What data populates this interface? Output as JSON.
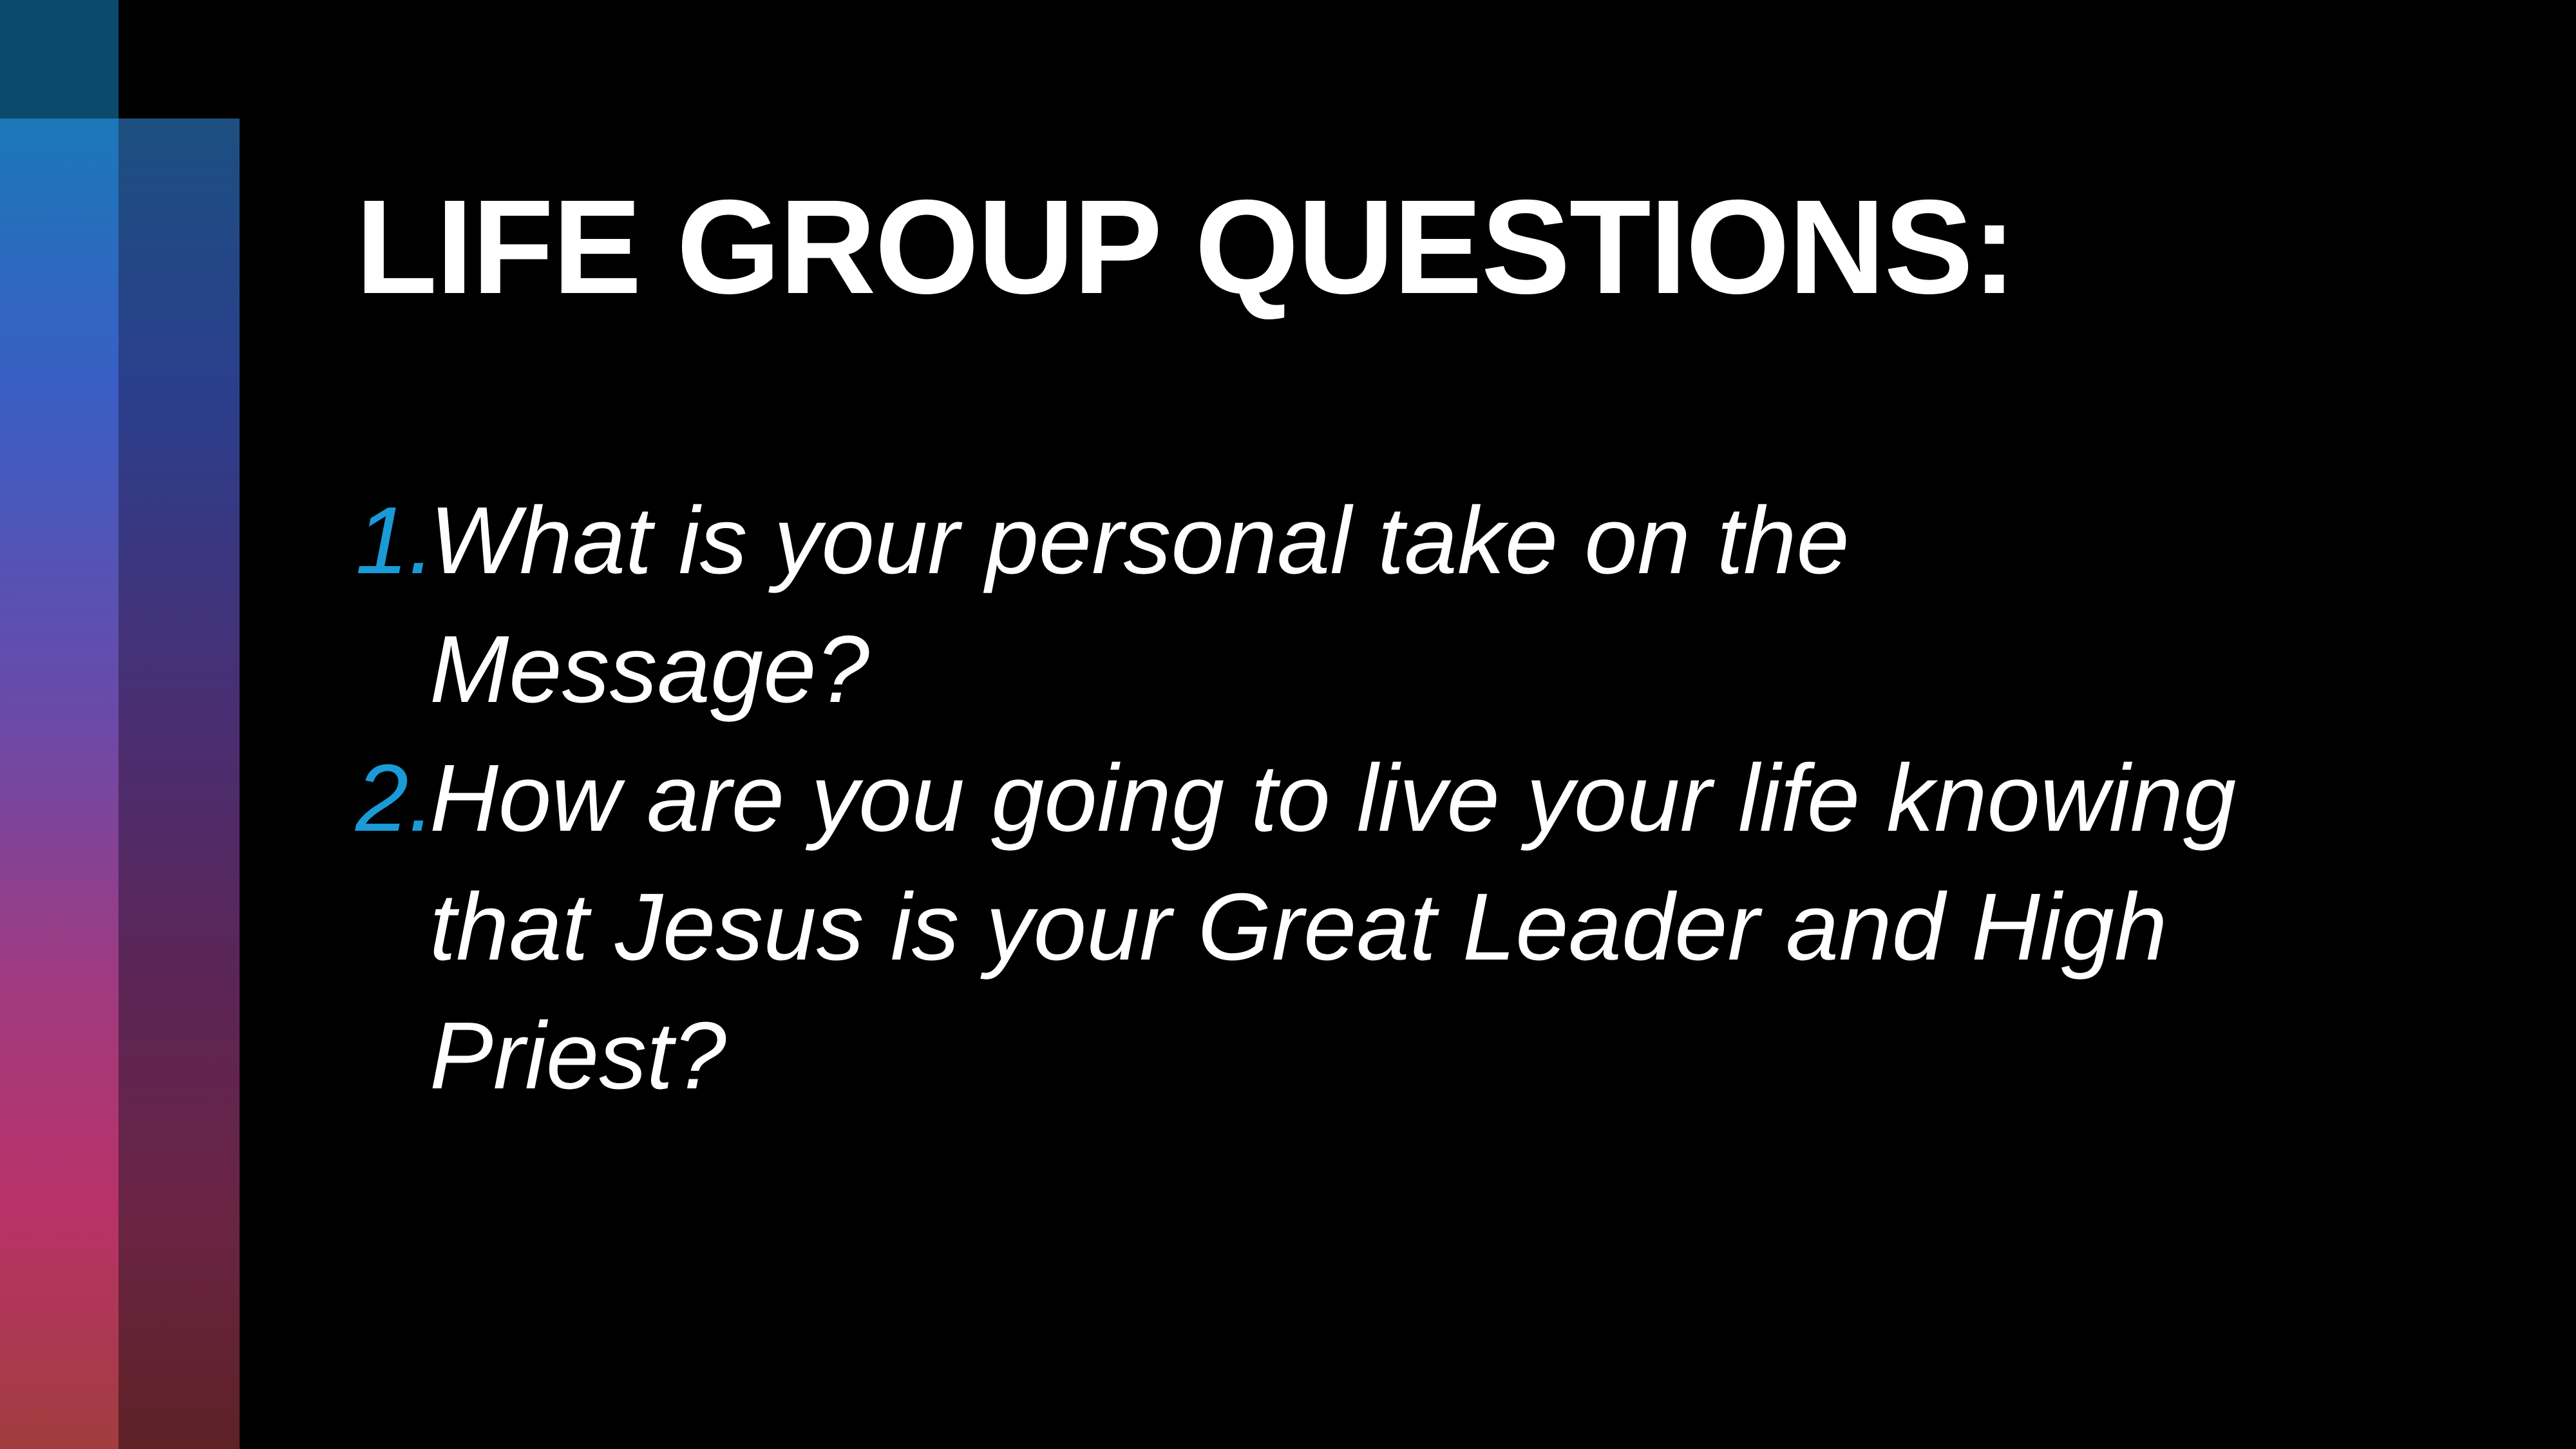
{
  "slide": {
    "title": "LIFE GROUP QUESTIONS:",
    "questions": [
      {
        "number": "1.",
        "lines": [
          "What is your personal take on the",
          "Message?"
        ]
      },
      {
        "number": "2.",
        "lines": [
          "How are you going to live your life knowing",
          "that Jesus is your Great Leader and High",
          "Priest?"
        ]
      }
    ]
  },
  "colors": {
    "background": "#000000",
    "text": "#ffffff",
    "number_accent": "#1a9ad6",
    "bar_gradient_top": "#1a78b8",
    "bar_gradient_bottom": "#a13d3e"
  }
}
